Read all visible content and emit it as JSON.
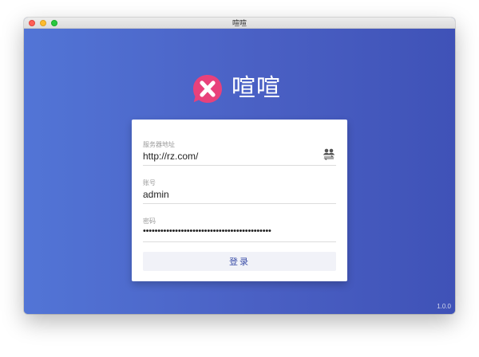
{
  "window": {
    "title": "喧喧"
  },
  "brand": {
    "name": "喧喧",
    "logo_icon": "chat-x-icon",
    "logo_color": "#e8417b"
  },
  "login": {
    "server_label": "服务器地址",
    "server_value": "http://rz.com/",
    "account_label": "账号",
    "account_value": "admin",
    "password_label": "密码",
    "password_value": "••••••••••••••••••••••••••••••••••••••••••••",
    "button_label": "登录",
    "switch_icon": "user-switch-icon"
  },
  "footer": {
    "version": "1.0.0"
  },
  "colors": {
    "background_left": "#5275d6",
    "background_right": "#3f52b7",
    "button_text": "#3c4fa8"
  }
}
